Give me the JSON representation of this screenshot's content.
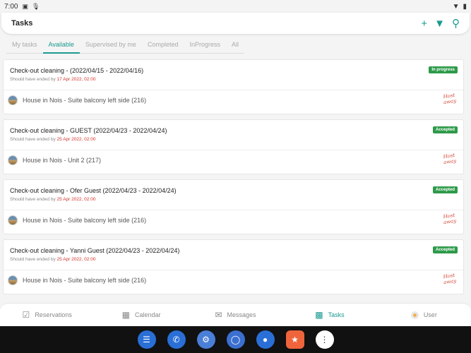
{
  "status_bar": {
    "time": "7:00"
  },
  "appbar": {
    "title": "Tasks"
  },
  "tabs": [
    {
      "label": "My tasks"
    },
    {
      "label": "Available"
    },
    {
      "label": "Supervised by me"
    },
    {
      "label": "Completed"
    },
    {
      "label": "InProgress"
    },
    {
      "label": "All"
    }
  ],
  "tasks": [
    {
      "title": "Check-out cleaning - (2022/04/15 - 2022/04/16)",
      "due_prefix": "Should have ended by",
      "due_date": "17 Apr 2022, 02:00",
      "status": "In progress",
      "property": "House in Nois - Suite balcony left side (216)"
    },
    {
      "title": "Check-out cleaning - GUEST (2022/04/23 - 2022/04/24)",
      "due_prefix": "Should have ended by",
      "due_date": "25 Apr 2022, 02:00",
      "status": "Accepted",
      "property": "House in Nois - Unit 2 (217)"
    },
    {
      "title": "Check-out cleaning - Ofer Guest (2022/04/23 - 2022/04/24)",
      "due_prefix": "Should have ended by",
      "due_date": "25 Apr 2022, 02:00",
      "status": "Accepted",
      "property": "House in Nois - Suite balcony left side (216)"
    },
    {
      "title": "Check-out cleaning - Yanni Guest (2022/04/23 - 2022/04/24)",
      "due_prefix": "Should have ended by",
      "due_date": "25 Apr 2022, 02:00",
      "status": "Accepted",
      "property": "House in Nois - Suite balcony left side (216)"
    }
  ],
  "logo": {
    "line1": "Host",
    "line2": "away"
  },
  "bottom_nav": [
    {
      "label": "Reservations",
      "icon": "calendar-check-icon"
    },
    {
      "label": "Calendar",
      "icon": "calendar-icon"
    },
    {
      "label": "Messages",
      "icon": "chat-icon"
    },
    {
      "label": "Tasks",
      "icon": "briefcase-icon"
    },
    {
      "label": "User",
      "icon": "user-avatar-icon"
    }
  ],
  "colors": {
    "accent": "#1a9a92",
    "status_green": "#2e9a4a",
    "due_red": "#d0342c"
  }
}
